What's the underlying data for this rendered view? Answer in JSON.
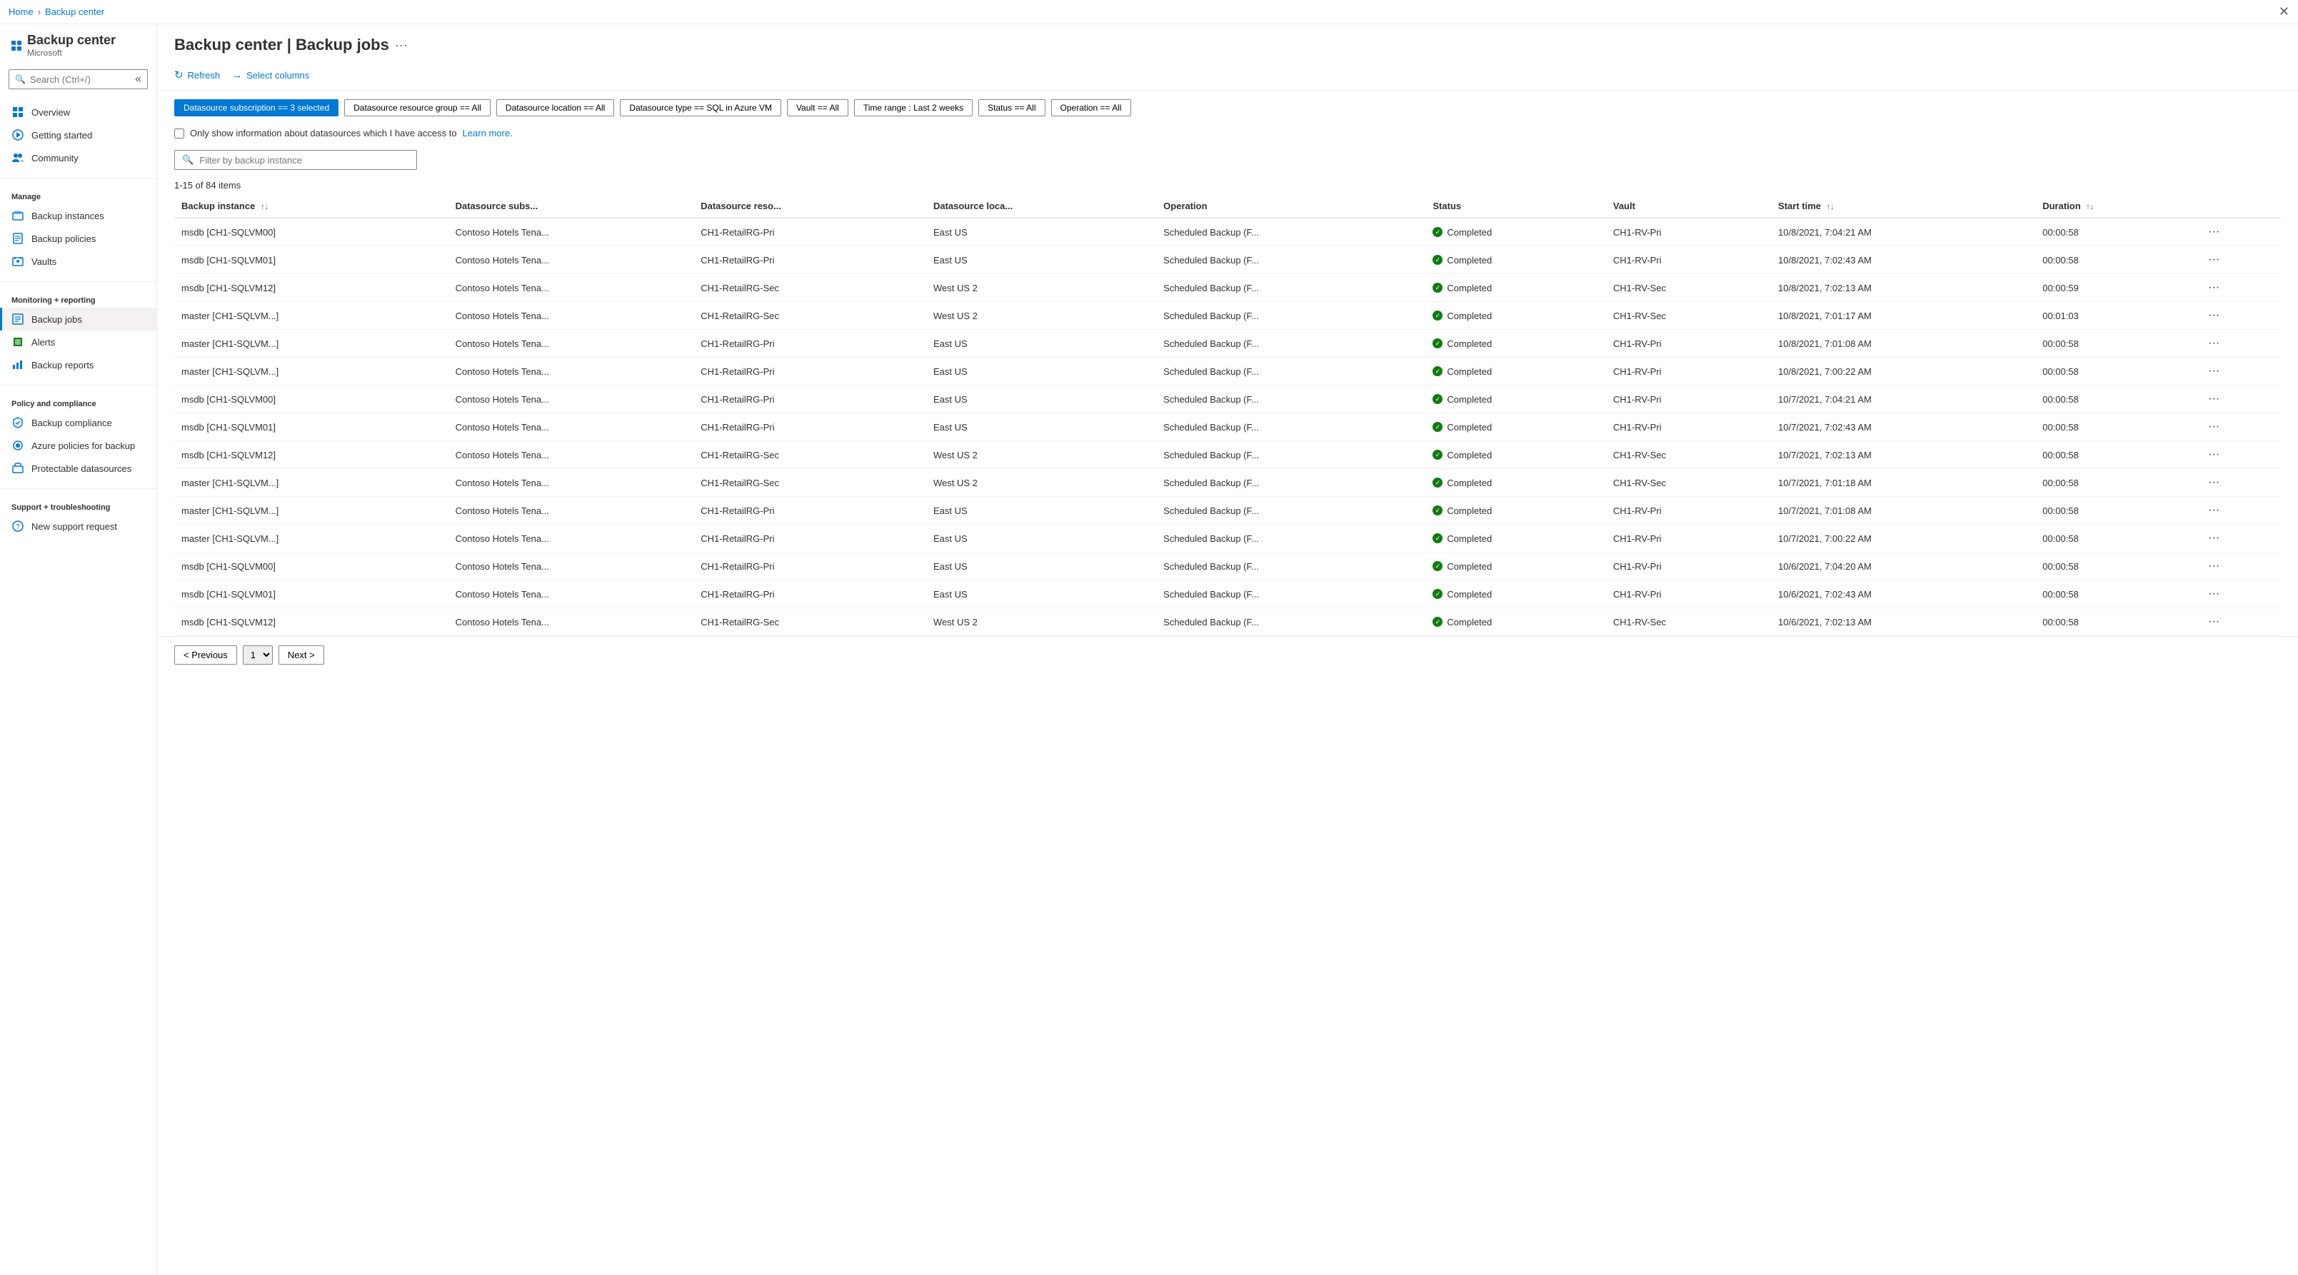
{
  "breadcrumb": {
    "home": "Home",
    "section": "Backup center"
  },
  "header": {
    "title": "Backup center | Backup jobs",
    "subtitle": "Microsoft",
    "more_label": "···"
  },
  "sidebar": {
    "search_placeholder": "Search (Ctrl+/)",
    "collapse_icon": "«",
    "nav": {
      "items": [
        {
          "id": "overview",
          "label": "Overview",
          "icon": "overview"
        },
        {
          "id": "getting-started",
          "label": "Getting started",
          "icon": "start"
        },
        {
          "id": "community",
          "label": "Community",
          "icon": "community"
        }
      ],
      "manage_label": "Manage",
      "manage_items": [
        {
          "id": "backup-instances",
          "label": "Backup instances",
          "icon": "backup-instance"
        },
        {
          "id": "backup-policies",
          "label": "Backup policies",
          "icon": "policy"
        },
        {
          "id": "vaults",
          "label": "Vaults",
          "icon": "vault"
        }
      ],
      "monitoring_label": "Monitoring + reporting",
      "monitoring_items": [
        {
          "id": "backup-jobs",
          "label": "Backup jobs",
          "icon": "jobs",
          "active": true
        },
        {
          "id": "alerts",
          "label": "Alerts",
          "icon": "alert"
        },
        {
          "id": "backup-reports",
          "label": "Backup reports",
          "icon": "report"
        }
      ],
      "policy_label": "Policy and compliance",
      "policy_items": [
        {
          "id": "backup-compliance",
          "label": "Backup compliance",
          "icon": "compliance"
        },
        {
          "id": "azure-policies",
          "label": "Azure policies for backup",
          "icon": "azure-policy"
        },
        {
          "id": "protectable",
          "label": "Protectable datasources",
          "icon": "datasource"
        }
      ],
      "support_label": "Support + troubleshooting",
      "support_items": [
        {
          "id": "new-support",
          "label": "New support request",
          "icon": "support"
        }
      ]
    }
  },
  "toolbar": {
    "refresh_label": "Refresh",
    "select_columns_label": "Select columns"
  },
  "filters": {
    "chips": [
      {
        "id": "subscription",
        "label": "Datasource subscription == 3 selected",
        "active": true
      },
      {
        "id": "resource-group",
        "label": "Datasource resource group == All",
        "active": false
      },
      {
        "id": "location",
        "label": "Datasource location == All",
        "active": false
      },
      {
        "id": "type",
        "label": "Datasource type == SQL in Azure VM",
        "active": false
      },
      {
        "id": "vault",
        "label": "Vault == All",
        "active": false
      },
      {
        "id": "time-range",
        "label": "Time range : Last 2 weeks",
        "active": false
      },
      {
        "id": "status",
        "label": "Status == All",
        "active": false
      },
      {
        "id": "operation",
        "label": "Operation == All",
        "active": false
      }
    ],
    "checkbox_label": "Only show information about datasources which I have access to",
    "learn_more": "Learn more.",
    "search_placeholder": "Filter by backup instance"
  },
  "table": {
    "items_count": "1-15 of 84 items",
    "columns": [
      {
        "id": "backup-instance",
        "label": "Backup instance",
        "sortable": true
      },
      {
        "id": "datasource-subs",
        "label": "Datasource subs...",
        "sortable": false
      },
      {
        "id": "datasource-reso",
        "label": "Datasource reso...",
        "sortable": false
      },
      {
        "id": "datasource-loca",
        "label": "Datasource loca...",
        "sortable": false
      },
      {
        "id": "operation",
        "label": "Operation",
        "sortable": false
      },
      {
        "id": "status",
        "label": "Status",
        "sortable": false
      },
      {
        "id": "vault",
        "label": "Vault",
        "sortable": false
      },
      {
        "id": "start-time",
        "label": "Start time",
        "sortable": true
      },
      {
        "id": "duration",
        "label": "Duration",
        "sortable": true
      }
    ],
    "rows": [
      {
        "backup_instance": "msdb [CH1-SQLVM00]",
        "datasource_subs": "Contoso Hotels Tena...",
        "datasource_reso": "CH1-RetailRG-Pri",
        "datasource_loca": "East US",
        "operation": "Scheduled Backup (F...",
        "status": "Completed",
        "vault": "CH1-RV-Pri",
        "start_time": "10/8/2021, 7:04:21 AM",
        "duration": "00:00:58"
      },
      {
        "backup_instance": "msdb [CH1-SQLVM01]",
        "datasource_subs": "Contoso Hotels Tena...",
        "datasource_reso": "CH1-RetailRG-Pri",
        "datasource_loca": "East US",
        "operation": "Scheduled Backup (F...",
        "status": "Completed",
        "vault": "CH1-RV-Pri",
        "start_time": "10/8/2021, 7:02:43 AM",
        "duration": "00:00:58"
      },
      {
        "backup_instance": "msdb [CH1-SQLVM12]",
        "datasource_subs": "Contoso Hotels Tena...",
        "datasource_reso": "CH1-RetailRG-Sec",
        "datasource_loca": "West US 2",
        "operation": "Scheduled Backup (F...",
        "status": "Completed",
        "vault": "CH1-RV-Sec",
        "start_time": "10/8/2021, 7:02:13 AM",
        "duration": "00:00:59"
      },
      {
        "backup_instance": "master [CH1-SQLVM...]",
        "datasource_subs": "Contoso Hotels Tena...",
        "datasource_reso": "CH1-RetailRG-Sec",
        "datasource_loca": "West US 2",
        "operation": "Scheduled Backup (F...",
        "status": "Completed",
        "vault": "CH1-RV-Sec",
        "start_time": "10/8/2021, 7:01:17 AM",
        "duration": "00:01:03"
      },
      {
        "backup_instance": "master [CH1-SQLVM...]",
        "datasource_subs": "Contoso Hotels Tena...",
        "datasource_reso": "CH1-RetailRG-Pri",
        "datasource_loca": "East US",
        "operation": "Scheduled Backup (F...",
        "status": "Completed",
        "vault": "CH1-RV-Pri",
        "start_time": "10/8/2021, 7:01:08 AM",
        "duration": "00:00:58"
      },
      {
        "backup_instance": "master [CH1-SQLVM...]",
        "datasource_subs": "Contoso Hotels Tena...",
        "datasource_reso": "CH1-RetailRG-Pri",
        "datasource_loca": "East US",
        "operation": "Scheduled Backup (F...",
        "status": "Completed",
        "vault": "CH1-RV-Pri",
        "start_time": "10/8/2021, 7:00:22 AM",
        "duration": "00:00:58"
      },
      {
        "backup_instance": "msdb [CH1-SQLVM00]",
        "datasource_subs": "Contoso Hotels Tena...",
        "datasource_reso": "CH1-RetailRG-Pri",
        "datasource_loca": "East US",
        "operation": "Scheduled Backup (F...",
        "status": "Completed",
        "vault": "CH1-RV-Pri",
        "start_time": "10/7/2021, 7:04:21 AM",
        "duration": "00:00:58"
      },
      {
        "backup_instance": "msdb [CH1-SQLVM01]",
        "datasource_subs": "Contoso Hotels Tena...",
        "datasource_reso": "CH1-RetailRG-Pri",
        "datasource_loca": "East US",
        "operation": "Scheduled Backup (F...",
        "status": "Completed",
        "vault": "CH1-RV-Pri",
        "start_time": "10/7/2021, 7:02:43 AM",
        "duration": "00:00:58"
      },
      {
        "backup_instance": "msdb [CH1-SQLVM12]",
        "datasource_subs": "Contoso Hotels Tena...",
        "datasource_reso": "CH1-RetailRG-Sec",
        "datasource_loca": "West US 2",
        "operation": "Scheduled Backup (F...",
        "status": "Completed",
        "vault": "CH1-RV-Sec",
        "start_time": "10/7/2021, 7:02:13 AM",
        "duration": "00:00:58"
      },
      {
        "backup_instance": "master [CH1-SQLVM...]",
        "datasource_subs": "Contoso Hotels Tena...",
        "datasource_reso": "CH1-RetailRG-Sec",
        "datasource_loca": "West US 2",
        "operation": "Scheduled Backup (F...",
        "status": "Completed",
        "vault": "CH1-RV-Sec",
        "start_time": "10/7/2021, 7:01:18 AM",
        "duration": "00:00:58"
      },
      {
        "backup_instance": "master [CH1-SQLVM...]",
        "datasource_subs": "Contoso Hotels Tena...",
        "datasource_reso": "CH1-RetailRG-Pri",
        "datasource_loca": "East US",
        "operation": "Scheduled Backup (F...",
        "status": "Completed",
        "vault": "CH1-RV-Pri",
        "start_time": "10/7/2021, 7:01:08 AM",
        "duration": "00:00:58"
      },
      {
        "backup_instance": "master [CH1-SQLVM...]",
        "datasource_subs": "Contoso Hotels Tena...",
        "datasource_reso": "CH1-RetailRG-Pri",
        "datasource_loca": "East US",
        "operation": "Scheduled Backup (F...",
        "status": "Completed",
        "vault": "CH1-RV-Pri",
        "start_time": "10/7/2021, 7:00:22 AM",
        "duration": "00:00:58"
      },
      {
        "backup_instance": "msdb [CH1-SQLVM00]",
        "datasource_subs": "Contoso Hotels Tena...",
        "datasource_reso": "CH1-RetailRG-Pri",
        "datasource_loca": "East US",
        "operation": "Scheduled Backup (F...",
        "status": "Completed",
        "vault": "CH1-RV-Pri",
        "start_time": "10/6/2021, 7:04:20 AM",
        "duration": "00:00:58"
      },
      {
        "backup_instance": "msdb [CH1-SQLVM01]",
        "datasource_subs": "Contoso Hotels Tena...",
        "datasource_reso": "CH1-RetailRG-Pri",
        "datasource_loca": "East US",
        "operation": "Scheduled Backup (F...",
        "status": "Completed",
        "vault": "CH1-RV-Pri",
        "start_time": "10/6/2021, 7:02:43 AM",
        "duration": "00:00:58"
      },
      {
        "backup_instance": "msdb [CH1-SQLVM12]",
        "datasource_subs": "Contoso Hotels Tena...",
        "datasource_reso": "CH1-RetailRG-Sec",
        "datasource_loca": "West US 2",
        "operation": "Scheduled Backup (F...",
        "status": "Completed",
        "vault": "CH1-RV-Sec",
        "start_time": "10/6/2021, 7:02:13 AM",
        "duration": "00:00:58"
      }
    ]
  },
  "pagination": {
    "previous_label": "< Previous",
    "next_label": "Next >",
    "current_page": "1"
  }
}
